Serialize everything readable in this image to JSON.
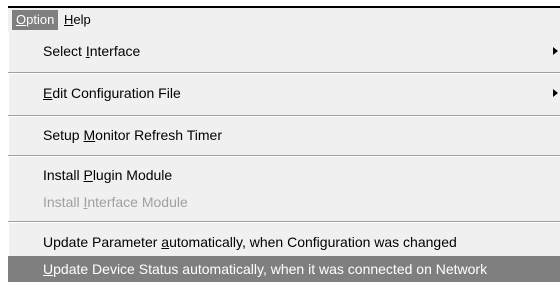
{
  "menubar": {
    "option": {
      "label_u": "O",
      "label_rest": "ption"
    },
    "help": {
      "label_u": "H",
      "label_rest": "elp"
    }
  },
  "menu": {
    "select_interface": {
      "pre": "Select ",
      "u": "I",
      "post": "nterface"
    },
    "edit_config": {
      "pre": "",
      "u": "E",
      "post": "dit Configuration File"
    },
    "setup_monitor": {
      "pre": "Setup ",
      "u": "M",
      "post": "onitor Refresh Timer"
    },
    "install_plugin": {
      "pre": "Install ",
      "u": "P",
      "post": "lugin Module"
    },
    "install_interface": {
      "pre": "Install ",
      "u": "I",
      "post": "nterface Module"
    },
    "update_parameter": {
      "pre": "Update Parameter ",
      "u": "a",
      "post": "utomatically, when Configuration was changed"
    },
    "update_device": {
      "pre": "",
      "u": "U",
      "post": "pdate Device Status automatically, when it was connected on Network"
    }
  }
}
